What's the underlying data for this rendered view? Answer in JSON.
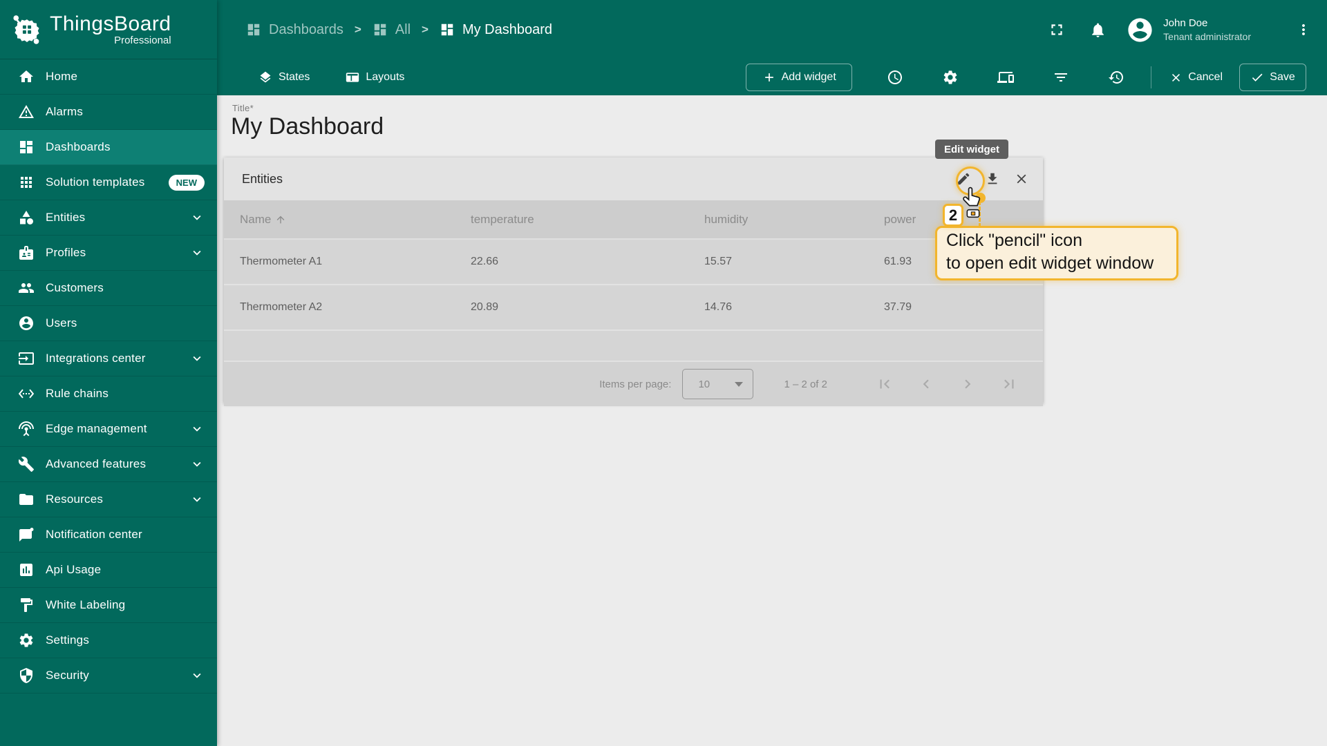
{
  "brand": {
    "name": "ThingsBoard",
    "edition": "Professional"
  },
  "sidebar": {
    "items": [
      {
        "label": "Home"
      },
      {
        "label": "Alarms"
      },
      {
        "label": "Dashboards",
        "selected": true
      },
      {
        "label": "Solution templates",
        "badge": "NEW"
      },
      {
        "label": "Entities",
        "expandable": true
      },
      {
        "label": "Profiles",
        "expandable": true
      },
      {
        "label": "Customers"
      },
      {
        "label": "Users"
      },
      {
        "label": "Integrations center",
        "expandable": true
      },
      {
        "label": "Rule chains"
      },
      {
        "label": "Edge management",
        "expandable": true
      },
      {
        "label": "Advanced features",
        "expandable": true
      },
      {
        "label": "Resources",
        "expandable": true
      },
      {
        "label": "Notification center"
      },
      {
        "label": "Api Usage"
      },
      {
        "label": "White Labeling"
      },
      {
        "label": "Settings"
      },
      {
        "label": "Security",
        "expandable": true
      }
    ]
  },
  "breadcrumb": {
    "separator": ">",
    "items": [
      {
        "label": "Dashboards"
      },
      {
        "label": "All"
      },
      {
        "label": "My Dashboard"
      }
    ]
  },
  "user": {
    "name": "John Doe",
    "role": "Tenant administrator"
  },
  "toolbar": {
    "states_label": "States",
    "layouts_label": "Layouts",
    "add_widget_label": "Add widget",
    "cancel_label": "Cancel",
    "save_label": "Save"
  },
  "page": {
    "title_label": "Title*",
    "title": "My Dashboard"
  },
  "widget": {
    "title": "Entities",
    "edit_tooltip": "Edit widget",
    "table": {
      "columns": [
        "Name",
        "temperature",
        "humidity",
        "power"
      ],
      "rows": [
        [
          "Thermometer A1",
          "22.66",
          "15.57",
          "61.93"
        ],
        [
          "Thermometer A2",
          "20.89",
          "14.76",
          "37.79"
        ]
      ]
    },
    "pagination": {
      "items_per_page_label": "Items per page:",
      "page_size": "10",
      "range": "1 – 2 of 2"
    }
  },
  "annotation": {
    "step": "2",
    "line1": "Click \"pencil\" icon",
    "line2": "to open edit widget window"
  },
  "colors": {
    "sidebar_teal": "#02695C",
    "selected_teal": "#0E8074",
    "accent_gold": "#F2B52D",
    "callout_bg": "#FBF0DB",
    "tooltip_bg": "#5E5E5E",
    "content_bg": "#ECECEC",
    "widget_bg": "#D5D5D5"
  }
}
